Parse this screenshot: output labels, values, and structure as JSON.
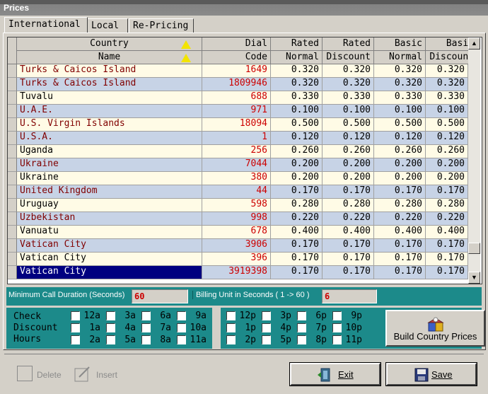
{
  "window": {
    "title": "Prices"
  },
  "tabs": [
    "International",
    "Local",
    "Re-Pricing"
  ],
  "grid": {
    "headers_top": [
      "Country",
      "Dial",
      "Rated",
      "Rated",
      "Basic",
      "Basic"
    ],
    "headers_bottom": [
      "Name",
      "Code",
      "Normal",
      "Discount",
      "Normal",
      "Discount"
    ],
    "rows": [
      {
        "name": "Turks & Caicos Island",
        "code": "1649",
        "rn": "0.320",
        "rd": "0.320",
        "bn": "0.320",
        "bd": "0.320"
      },
      {
        "name": "Turks & Caicos Island",
        "code": "1809946",
        "rn": "0.320",
        "rd": "0.320",
        "bn": "0.320",
        "bd": "0.320"
      },
      {
        "name": "Tuvalu",
        "code": "688",
        "rn": "0.330",
        "rd": "0.330",
        "bn": "0.330",
        "bd": "0.330"
      },
      {
        "name": "U.A.E.",
        "code": "971",
        "rn": "0.100",
        "rd": "0.100",
        "bn": "0.100",
        "bd": "0.100"
      },
      {
        "name": "U.S. Virgin Islands",
        "code": "18094",
        "rn": "0.500",
        "rd": "0.500",
        "bn": "0.500",
        "bd": "0.500"
      },
      {
        "name": "U.S.A.",
        "code": "1",
        "rn": "0.120",
        "rd": "0.120",
        "bn": "0.120",
        "bd": "0.120"
      },
      {
        "name": "Uganda",
        "code": "256",
        "rn": "0.260",
        "rd": "0.260",
        "bn": "0.260",
        "bd": "0.260"
      },
      {
        "name": "Ukraine",
        "code": "7044",
        "rn": "0.200",
        "rd": "0.200",
        "bn": "0.200",
        "bd": "0.200"
      },
      {
        "name": "Ukraine",
        "code": "380",
        "rn": "0.200",
        "rd": "0.200",
        "bn": "0.200",
        "bd": "0.200"
      },
      {
        "name": "United Kingdom",
        "code": "44",
        "rn": "0.170",
        "rd": "0.170",
        "bn": "0.170",
        "bd": "0.170"
      },
      {
        "name": "Uruguay",
        "code": "598",
        "rn": "0.280",
        "rd": "0.280",
        "bn": "0.280",
        "bd": "0.280"
      },
      {
        "name": "Uzbekistan",
        "code": "998",
        "rn": "0.220",
        "rd": "0.220",
        "bn": "0.220",
        "bd": "0.220"
      },
      {
        "name": "Vanuatu",
        "code": "678",
        "rn": "0.400",
        "rd": "0.400",
        "bn": "0.400",
        "bd": "0.400"
      },
      {
        "name": "Vatican City",
        "code": "3906",
        "rn": "0.170",
        "rd": "0.170",
        "bn": "0.170",
        "bd": "0.170"
      },
      {
        "name": "Vatican City",
        "code": "396",
        "rn": "0.170",
        "rd": "0.170",
        "bn": "0.170",
        "bd": "0.170"
      },
      {
        "name": "Vatican City",
        "code": "3919398",
        "rn": "0.170",
        "rd": "0.170",
        "bn": "0.170",
        "bd": "0.170",
        "selected": true
      }
    ]
  },
  "info": {
    "min_duration_label": "Minimum Call Duration (Seconds)",
    "min_duration_value": "60",
    "billing_unit_label": "Billing Unit in Seconds ( 1 -> 60 )",
    "billing_unit_value": "6"
  },
  "hours": {
    "labels": [
      "Check",
      "Discount",
      "Hours"
    ],
    "am": [
      "12a",
      "3a",
      "6a",
      "9a",
      "1a",
      "4a",
      "7a",
      "10a",
      "2a",
      "5a",
      "8a",
      "11a"
    ],
    "pm": [
      "12p",
      "3p",
      "6p",
      "9p",
      "1p",
      "4p",
      "7p",
      "10p",
      "2p",
      "5p",
      "8p",
      "11p"
    ]
  },
  "buttons": {
    "build": "Build Country Prices",
    "delete": "Delete",
    "insert": "Insert",
    "exit": "Exit",
    "save": "Save"
  },
  "colors": {
    "selection": "#000080",
    "teal_panel": "#1c8a8a",
    "row_odd": "#fffbe6",
    "row_even": "#c7d3e6",
    "name_text": "#800000",
    "code_text": "#cc0000"
  }
}
